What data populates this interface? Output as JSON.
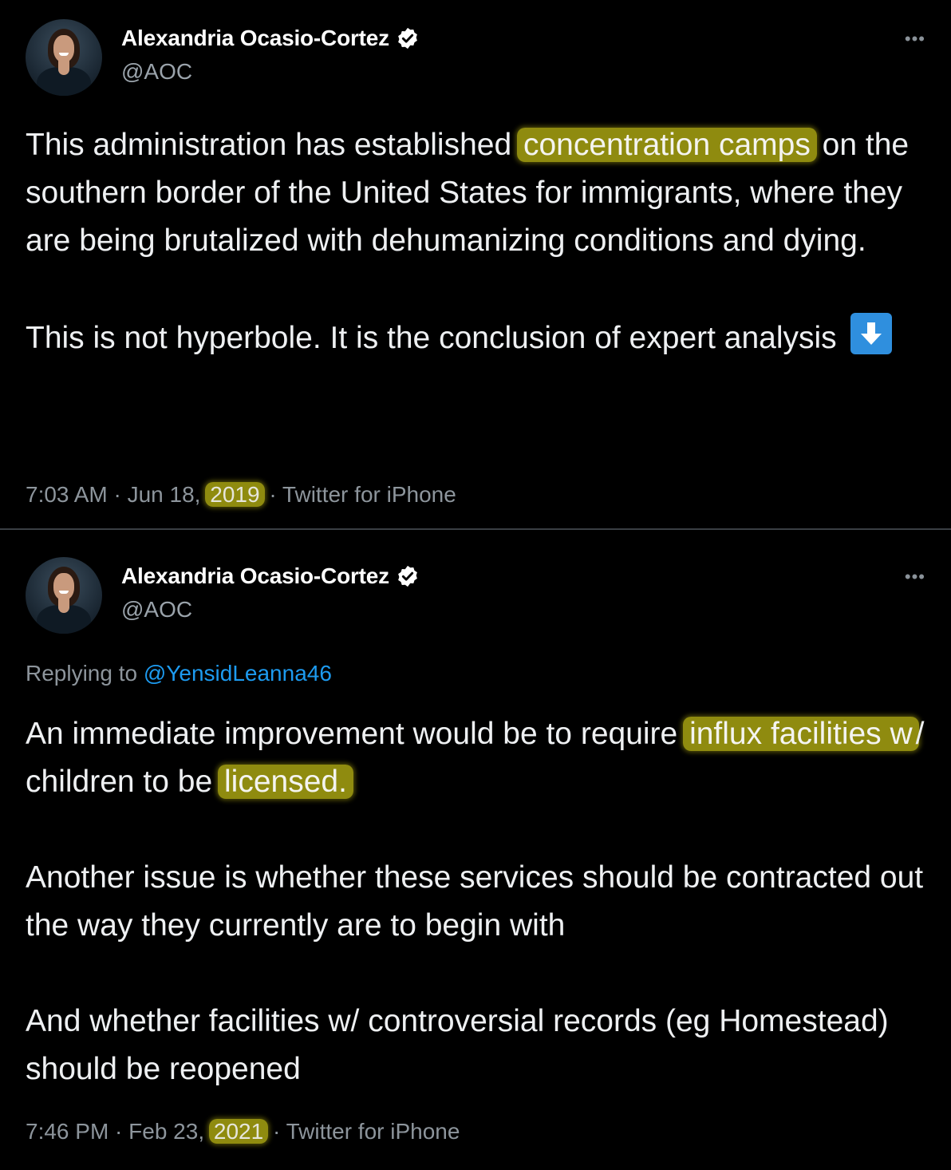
{
  "tweets": [
    {
      "author_name": "Alexandria Ocasio-Cortez",
      "handle": "@AOC",
      "more_label": "•••",
      "text_para1_before": "This administration has established ",
      "text_para1_highlight": "concentration camps",
      "text_para1_after": " on the southern border of the United States for immigrants, where they are being brutalized with dehumanizing conditions and dying.",
      "text_para2": "This is not hyperbole. It is the conclusion of expert analysis",
      "emoji": "down-arrow-icon",
      "time": "7:03 AM · Jun 18, ",
      "year": "2019",
      "source": " · Twitter for iPhone"
    },
    {
      "author_name": "Alexandria Ocasio-Cortez",
      "handle": "@AOC",
      "more_label": "•••",
      "replying_prefix": "Replying to ",
      "replying_handle": "@YensidLeanna46",
      "p1_a": "An immediate improvement would be to require ",
      "p1_hl1": "influx facilities w",
      "p1_b": "/ children to be ",
      "p1_hl2": "licensed.",
      "p2": "Another issue is whether these services should be contracted out the way they currently are to begin with",
      "p3": "And whether facilities w/ controversial records (eg Homestead) should be reopened",
      "time": "7:46 PM · Feb 23, ",
      "year": "2021",
      "source": " · Twitter for iPhone"
    }
  ],
  "colors": {
    "background": "#000000",
    "highlight": "#8f8b0f",
    "link": "#1d9bf0",
    "muted": "#8d959c"
  }
}
